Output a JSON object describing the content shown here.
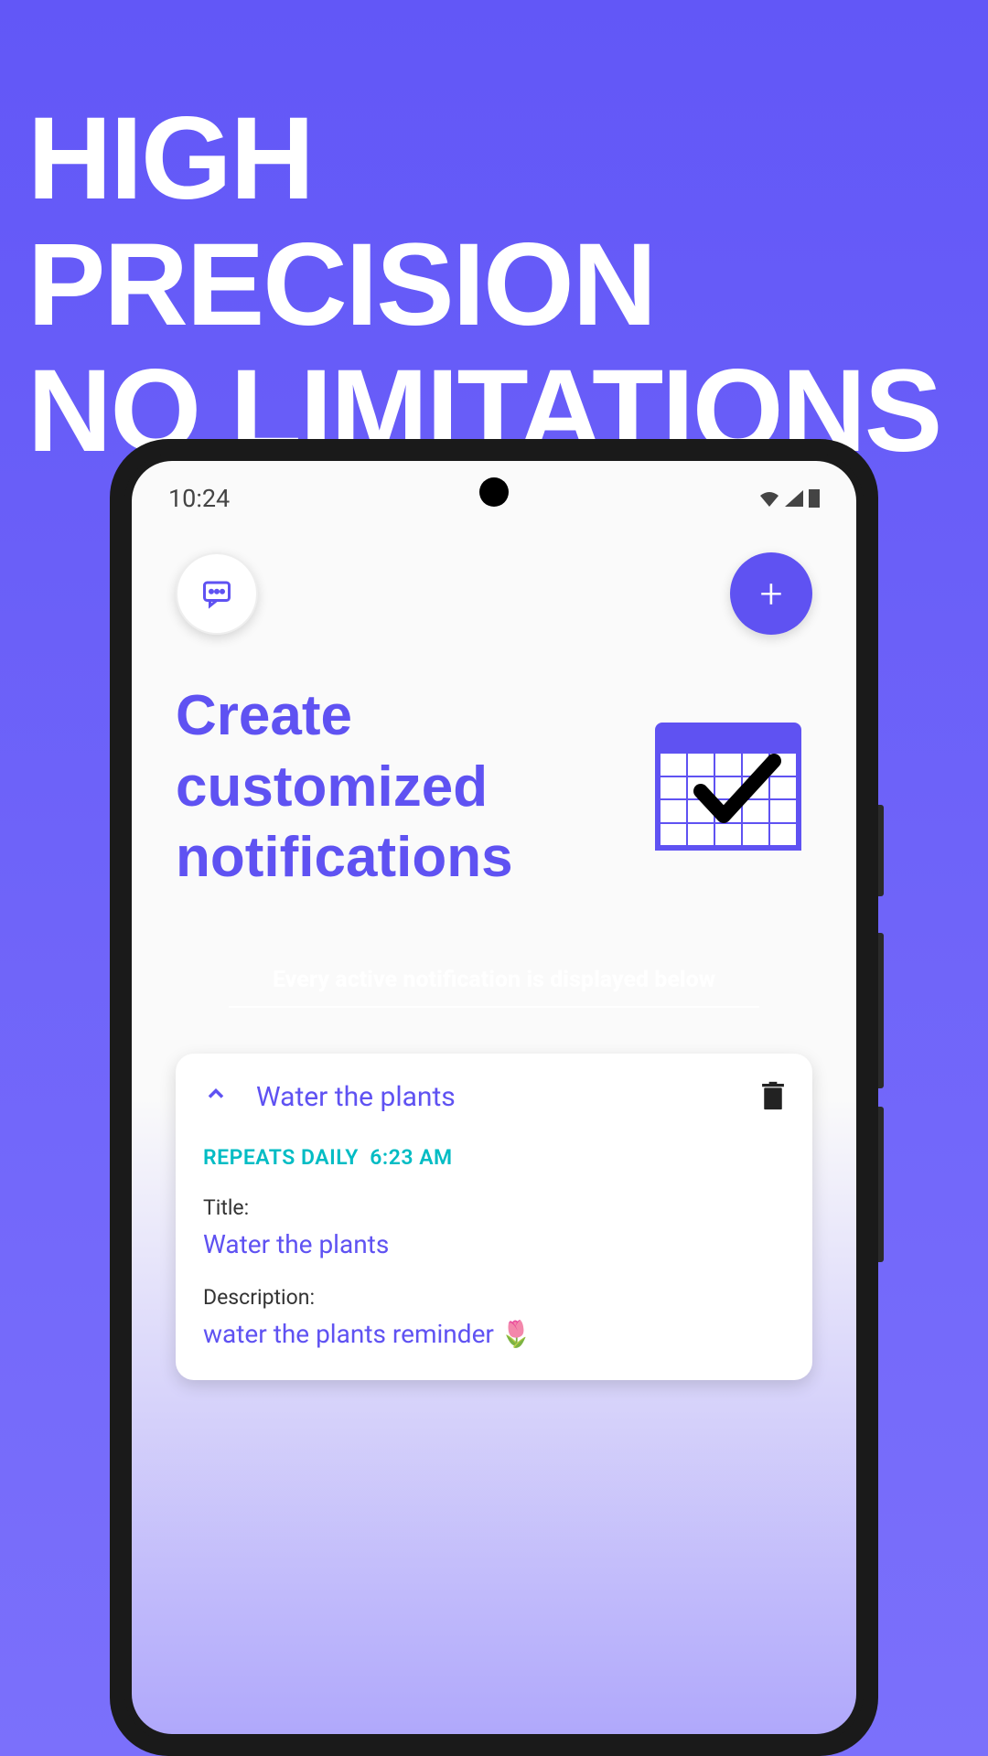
{
  "headline": {
    "line1": "HIGH PRECISION",
    "line2": "NO LIMITATIONS"
  },
  "status": {
    "time": "10:24"
  },
  "app": {
    "hero": {
      "line1": "Create",
      "line2": "customized",
      "line3": "notifications"
    },
    "subtitle": "Every active notification is displayed below",
    "add_label": "+"
  },
  "notification": {
    "title": "Water the plants",
    "repeat_text": "REPEATS DAILY",
    "repeat_time": "6:23 AM",
    "field_title_label": "Title:",
    "field_title_value": "Water the plants",
    "field_desc_label": "Description:",
    "field_desc_value": "water the plants reminder 🌷"
  }
}
